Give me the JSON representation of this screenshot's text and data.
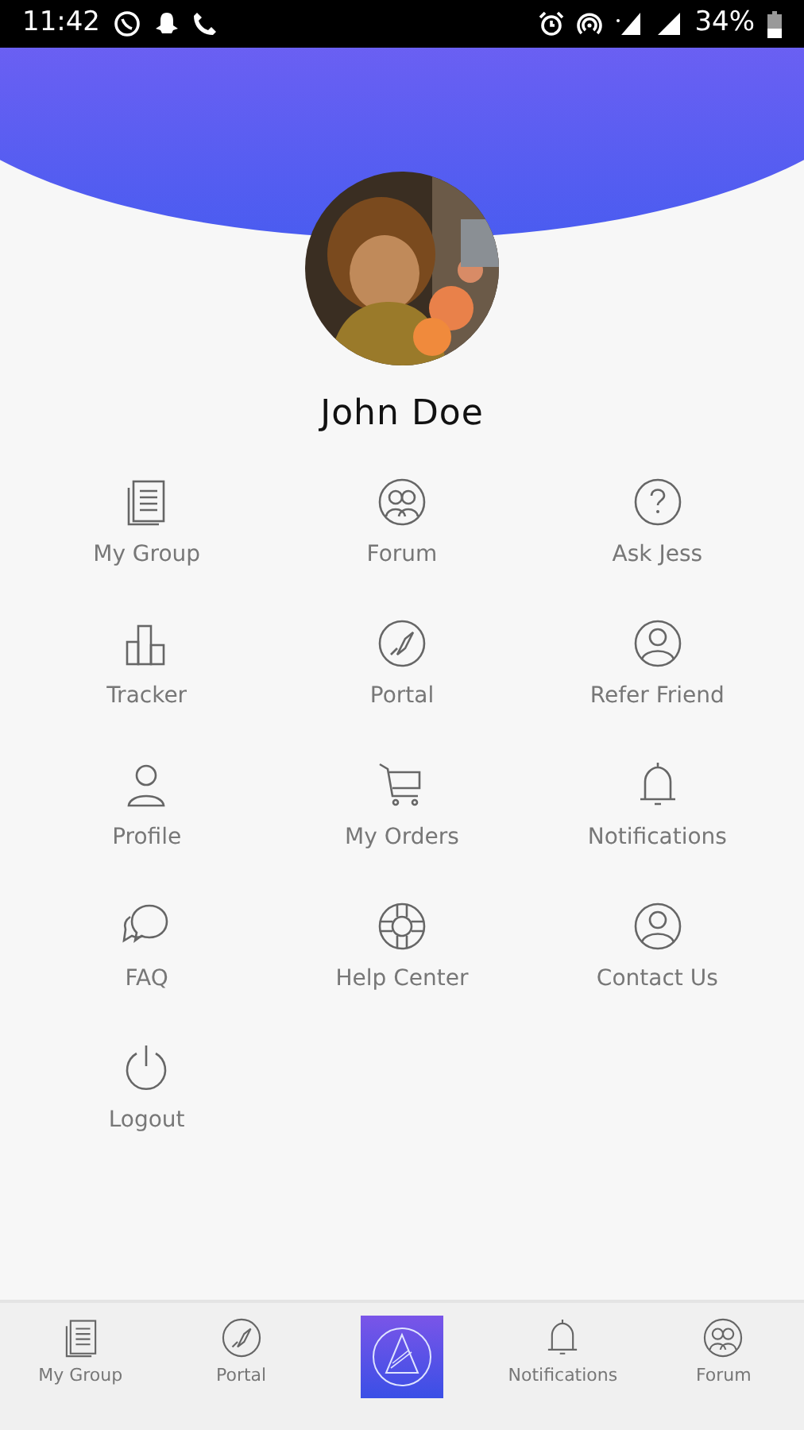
{
  "status_bar": {
    "time": "11:42",
    "battery": "34%"
  },
  "profile": {
    "name": "John Doe"
  },
  "menu": [
    {
      "label": "My Group"
    },
    {
      "label": "Forum"
    },
    {
      "label": "Ask Jess"
    },
    {
      "label": "Tracker"
    },
    {
      "label": "Portal"
    },
    {
      "label": "Refer Friend"
    },
    {
      "label": "Profile"
    },
    {
      "label": "My Orders"
    },
    {
      "label": "Notifications"
    },
    {
      "label": "FAQ"
    },
    {
      "label": "Help Center"
    },
    {
      "label": "Contact Us"
    },
    {
      "label": "Logout"
    }
  ],
  "bottom_nav": [
    {
      "label": "My Group",
      "kind": "tab"
    },
    {
      "label": "Portal",
      "kind": "tab"
    },
    {
      "kind": "logo"
    },
    {
      "label": "Notifications",
      "kind": "tab"
    },
    {
      "label": "Forum",
      "kind": "tab"
    }
  ]
}
